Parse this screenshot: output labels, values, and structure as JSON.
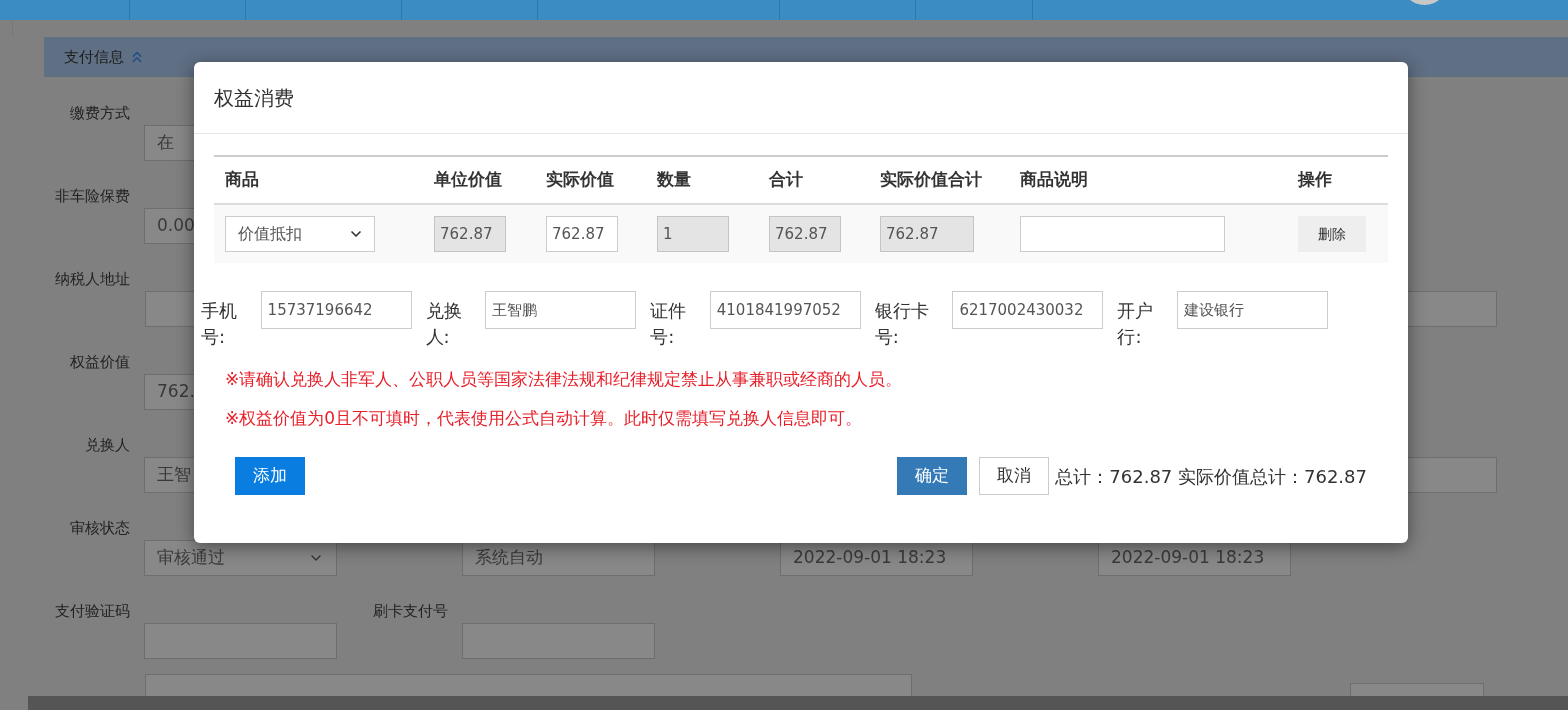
{
  "payment_section": {
    "title": "支付信息",
    "expanded": true
  },
  "form_rows": [
    {
      "cells": [
        {
          "label": "缴费方式",
          "value": "在",
          "kind": "input"
        }
      ]
    },
    {
      "cells": [
        {
          "label": "非车险保费",
          "value": "0.00",
          "kind": "input"
        }
      ]
    },
    {
      "cells": [
        {
          "label": "纳税人地址",
          "kind": "wide"
        }
      ]
    },
    {
      "cells": [
        {
          "label": "权益价值",
          "value": "762.",
          "kind": "input"
        }
      ]
    },
    {
      "cells": [
        {
          "label": "兑换人",
          "value": "王智",
          "kind": "input"
        },
        {
          "kind": "wide"
        }
      ]
    },
    {
      "cells": [
        {
          "label": "审核状态",
          "value": "审核通过",
          "kind": "select"
        },
        {
          "value": "系统自动",
          "kind": "input"
        },
        {
          "value": "2022-09-01 18:23",
          "kind": "input"
        },
        {
          "value": "2022-09-01 18:23",
          "kind": "input"
        }
      ]
    },
    {
      "cells": [
        {
          "label": "支付验证码",
          "kind": "input"
        },
        {
          "label": "刷卡支付号",
          "kind": "input"
        }
      ]
    },
    {
      "cells": [
        {
          "kind": "remark"
        },
        {
          "kind": "qr"
        }
      ]
    }
  ],
  "dialog": {
    "title": "权益消费",
    "table": {
      "columns": [
        "商品",
        "单位价值",
        "实际价值",
        "数量",
        "合计",
        "实际价值合计",
        "商品说明",
        "操作"
      ],
      "rows": [
        {
          "cells": [
            {
              "kind": "select",
              "value": "价值抵扣"
            },
            {
              "kind": "input",
              "value": "762.87",
              "readonly": true
            },
            {
              "kind": "input",
              "value": "762.87",
              "readonly": false
            },
            {
              "kind": "input",
              "value": "1",
              "readonly": true
            },
            {
              "kind": "input",
              "value": "762.87",
              "readonly": true
            },
            {
              "kind": "input",
              "value": "762.87",
              "readonly": true
            },
            {
              "kind": "input",
              "readonly": false
            },
            {
              "kind": "button",
              "label": "删除"
            }
          ]
        }
      ]
    },
    "fields": [
      {
        "label": "手机号:",
        "value": "15737196642"
      },
      {
        "label": "兑换人:",
        "value": "王智鹏"
      },
      {
        "label": "证件号:",
        "value": "4101841997052"
      },
      {
        "label": "银行卡号:",
        "value": "6217002430032"
      },
      {
        "label": "开户行:",
        "value": "建设银行"
      }
    ],
    "warnings": [
      "※请确认兑换人非军人、公职人员等国家法律法规和纪律规定禁止从事兼职或经商的人员。",
      "※权益价值为0且不可填时，代表使用公式自动计算。此时仅需填写兑换人信息即可。"
    ],
    "add_button": "添加",
    "confirm_button": "确定",
    "cancel_button": "取消",
    "totals": "总计：762.87 实际价值总计：762.87"
  }
}
